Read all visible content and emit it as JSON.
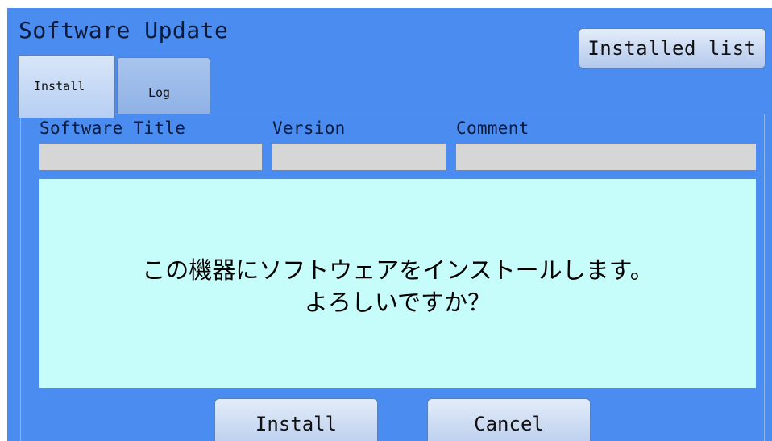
{
  "app": {
    "title": "Software Update"
  },
  "header": {
    "installed_list_label": "Installed list"
  },
  "tabs": [
    {
      "label": "Install",
      "active": true
    },
    {
      "label": "Log",
      "active": false
    }
  ],
  "columns": [
    {
      "label": "Software Title",
      "value": ""
    },
    {
      "label": "Version",
      "value": ""
    },
    {
      "label": "Comment",
      "value": ""
    }
  ],
  "message": {
    "line1": "この機器にソフトウェアをインストールします。",
    "line2": "よろしいですか？"
  },
  "buttons": {
    "install_label": "Install",
    "cancel_label": "Cancel"
  },
  "colors": {
    "screen_background": "#4a8cf0",
    "message_background": "#c6fcfa",
    "field_background": "#d6d6d6",
    "button_face": "#c6d8f2"
  }
}
